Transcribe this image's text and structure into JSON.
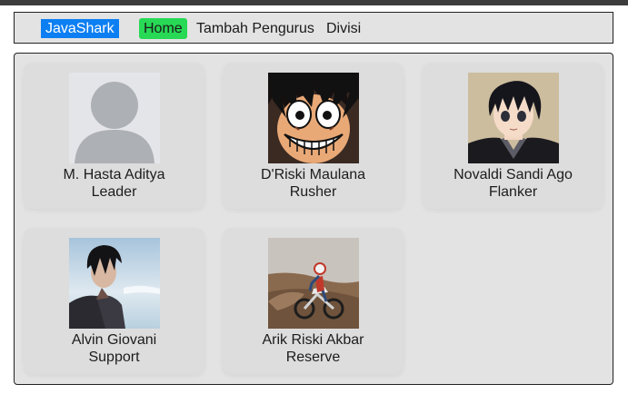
{
  "navbar": {
    "brand": "JavaShark",
    "links": [
      {
        "label": "Home",
        "active": true
      },
      {
        "label": "Tambah Pengurus",
        "active": false
      },
      {
        "label": "Divisi",
        "active": false
      }
    ]
  },
  "members": [
    {
      "name": "M. Hasta Aditya",
      "role": "Leader",
      "photo": "default-avatar"
    },
    {
      "name": "D'Riski Maulana",
      "role": "Rusher",
      "photo": "anime-pirate-grin"
    },
    {
      "name": "Novaldi Sandi Ago",
      "role": "Flanker",
      "photo": "anime-swordsman"
    },
    {
      "name": "Alvin Giovani",
      "role": "Support",
      "photo": "anime-dark-hair-sky"
    },
    {
      "name": "Arik Riski Akbar",
      "role": "Reserve",
      "photo": "motocross-rider"
    }
  ],
  "colors": {
    "brand_bg": "#0d7ff2",
    "active_link_bg": "#27d955",
    "panel_bg": "#e3e3e3",
    "card_bg": "#dddddd"
  }
}
